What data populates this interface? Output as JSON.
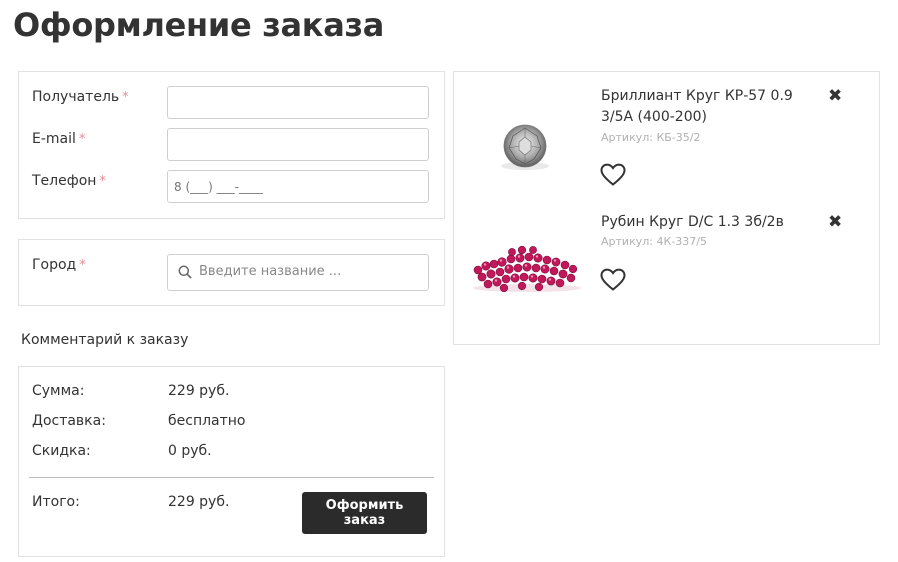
{
  "page": {
    "title": "Оформление заказа"
  },
  "form": {
    "recipient_label": "Получатель",
    "email_label": "E-mail",
    "phone_label": "Телефон",
    "phone_placeholder": "8 (___) ___-____",
    "required_mark": "*",
    "city_label": "Город",
    "city_placeholder": "Введите название ..."
  },
  "comment": {
    "label": "Комментарий к заказу"
  },
  "summary": {
    "sum_label": "Сумма:",
    "sum_value": "229 руб.",
    "delivery_label": "Доставка:",
    "delivery_value": "бесплатно",
    "discount_label": "Скидка:",
    "discount_value": "0 руб.",
    "total_label": "Итого:",
    "total_value": "229 руб.",
    "order_button": "Оформить заказ"
  },
  "cart": {
    "items": [
      {
        "name_line1": "Бриллиант Круг КР-57 0.9",
        "name_line2": "3/5А (400-200)",
        "article": "Артикул: КБ-35/2",
        "image": "diamond"
      },
      {
        "name_line1": "Рубин Круг D/С 1.3 3б/2в",
        "article": "Артикул: 4К-337/5",
        "image": "rubies"
      }
    ]
  },
  "icons": {
    "close": "close-icon",
    "favorite": "heart-icon",
    "search": "search-icon"
  },
  "colors": {
    "required": "#e88a94",
    "button_bg": "#2b2b2b",
    "ruby": "#c2185b"
  }
}
